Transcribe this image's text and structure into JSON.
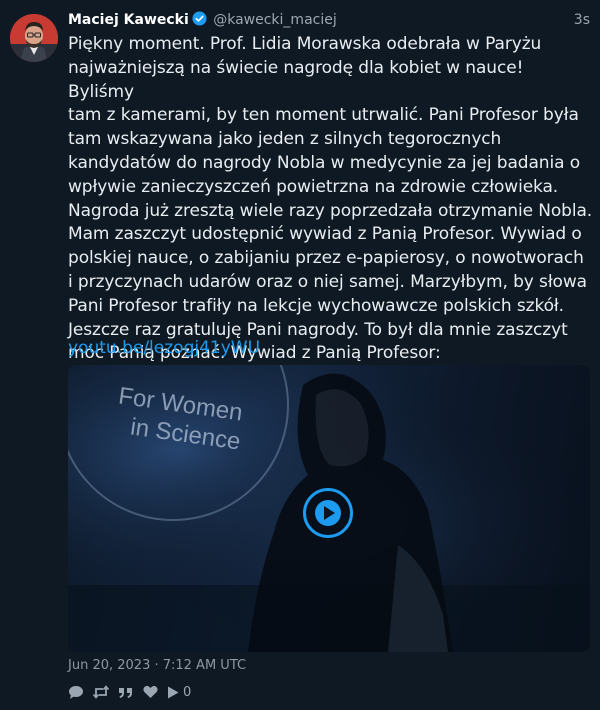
{
  "author": {
    "name": "Maciej Kawecki",
    "handle": "@kawecki_maciej",
    "verified": true,
    "avatar": "avatar-portrait"
  },
  "post": {
    "relative_time": "3s",
    "text": "Piękny moment. Prof. Lidia Morawska odebrała w Paryżu\nnajważniejszą na świecie nagrodę dla kobiet w nauce! Byliśmy\ntam z kamerami, by ten moment utrwalić. Pani Profesor była\ntam wskazywana jako jeden z silnych tegorocznych\nkandydatów do nagrody Nobla w medycynie za jej badania o\nwpływie zanieczyszczeń powietrzna na zdrowie człowieka.\nNagroda już zresztą wiele razy poprzedzała otrzymanie Nobla.\nMam zaszczyt udostępnić wywiad z Panią Profesor. Wywiad o\npolskiej nauce, o zabijaniu przez e-papierosy, o nowotworach\ni przyczynach udarów oraz o niej samej. Marzyłbym, by słowa\nPani Profesor trafiły na lekcje wychowawcze polskich szkół.\nJeszcze raz gratuluję Pani nagrody. To był dla mnie zaszczyt\nmóc Panią poznać. Wywiad z Panią Profesor:",
    "link": "youtu.be/lezogj41yWU",
    "timestamp": "Jun 20, 2023 · 7:12 AM UTC"
  },
  "media": {
    "type": "video",
    "overlay_text_line1": "For Women",
    "overlay_text_line2": "in Science",
    "play_icon": "play-icon"
  },
  "actions": [
    {
      "name": "reply-icon"
    },
    {
      "name": "retweet-icon"
    },
    {
      "name": "quote-icon"
    },
    {
      "name": "like-icon"
    },
    {
      "name": "views-icon",
      "count": "0"
    }
  ],
  "colors": {
    "background": "#0f1923",
    "accent": "#1d9bf0",
    "muted": "#9aa7b2"
  }
}
